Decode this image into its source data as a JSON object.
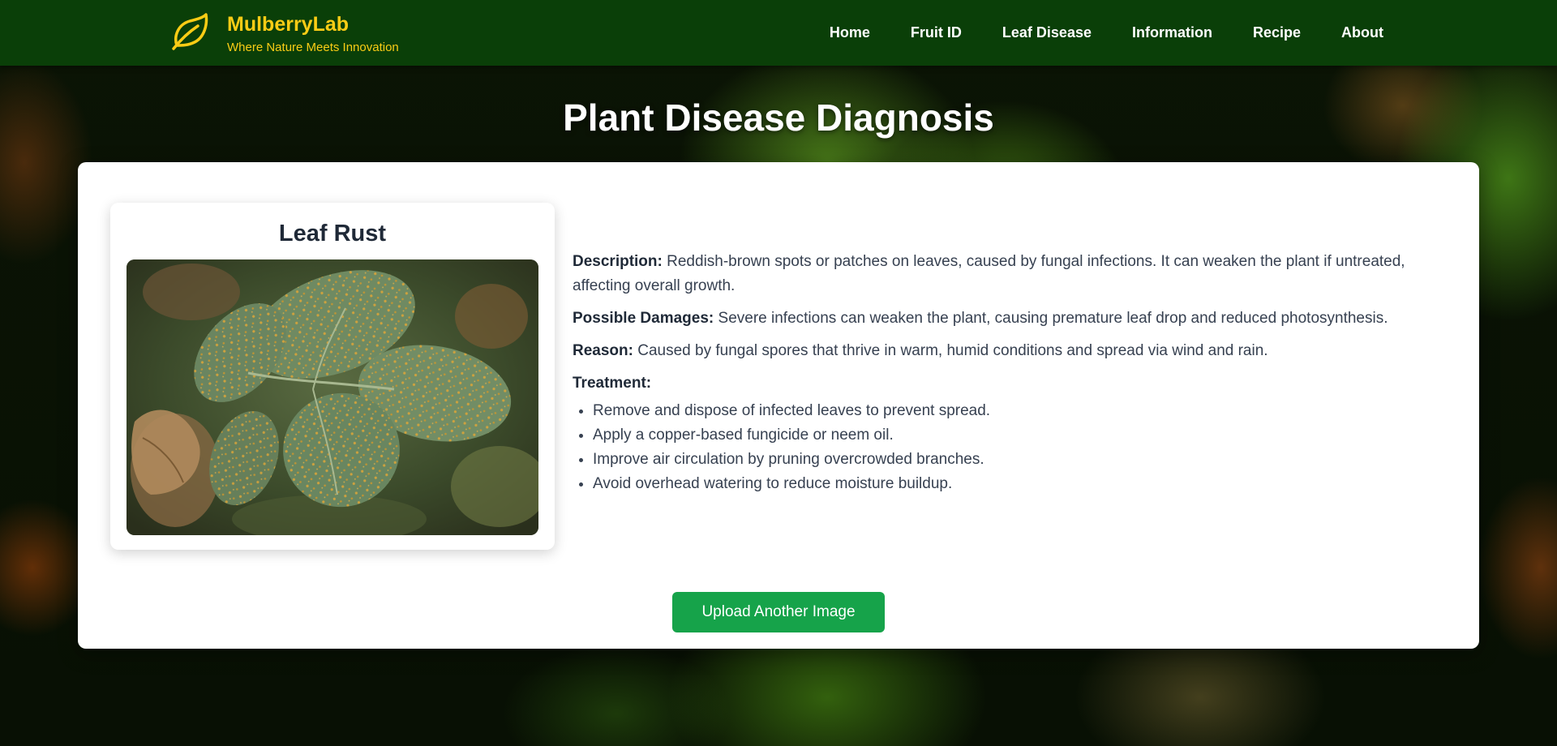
{
  "brand": {
    "name": "MulberryLab",
    "tagline": "Where Nature Meets Innovation",
    "icon": "leaf-icon",
    "color": "#facc15"
  },
  "nav": {
    "items": [
      {
        "label": "Home"
      },
      {
        "label": "Fruit ID"
      },
      {
        "label": "Leaf Disease"
      },
      {
        "label": "Information"
      },
      {
        "label": "Recipe"
      },
      {
        "label": "About"
      }
    ],
    "background": "#0a3f08"
  },
  "page": {
    "title": "Plant Disease Diagnosis"
  },
  "result": {
    "disease_name": "Leaf Rust",
    "description_label": "Description:",
    "description": "Reddish-brown spots or patches on leaves, caused by fungal infections. It can weaken the plant if untreated, affecting overall growth.",
    "damages_label": "Possible Damages:",
    "damages": "Severe infections can weaken the plant, causing premature leaf drop and reduced photosynthesis.",
    "reason_label": "Reason:",
    "reason": "Caused by fungal spores that thrive in warm, humid conditions and spread via wind and rain.",
    "treatment_label": "Treatment:",
    "treatments": [
      "Remove and dispose of infected leaves to prevent spread.",
      "Apply a copper-based fungicide or neem oil.",
      "Improve air circulation by pruning overcrowded branches.",
      "Avoid overhead watering to reduce moisture buildup."
    ]
  },
  "actions": {
    "upload_label": "Upload Another Image",
    "upload_color": "#16a34a"
  }
}
